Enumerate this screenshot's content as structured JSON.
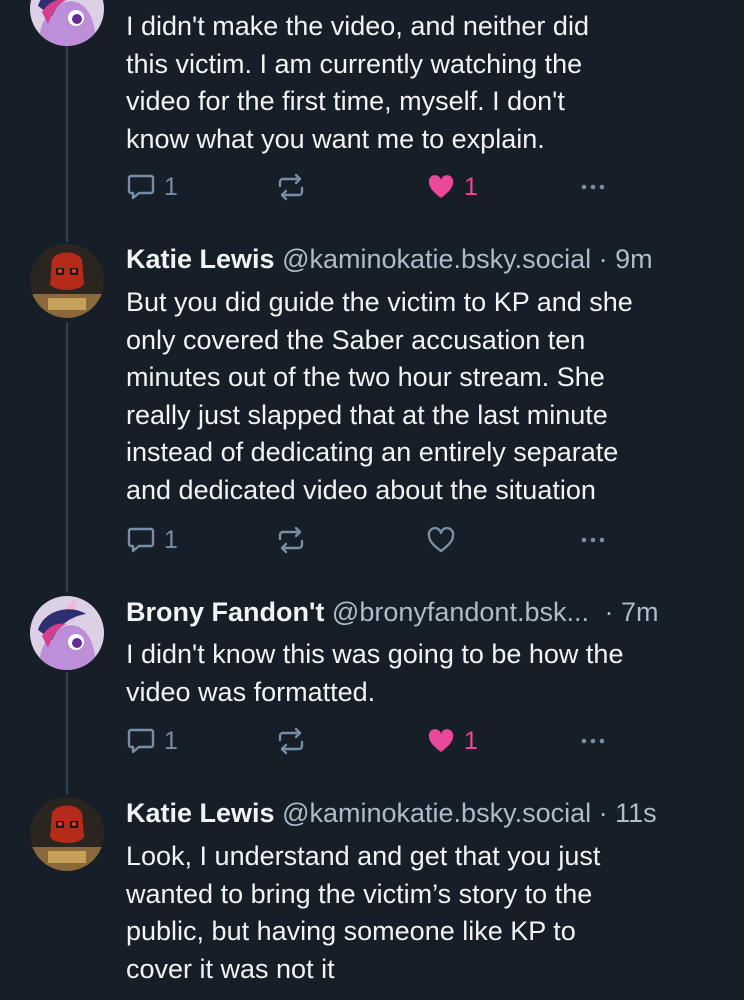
{
  "posts": [
    {
      "author_name": "",
      "handle": "",
      "time": "",
      "text_lines": [
        "I didn't make the video, and neither did",
        "this victim. I am currently watching the",
        "video for the first time, myself. I don't",
        "know what you want me to explain."
      ],
      "reply_count": "1",
      "repost_count": "",
      "like_count": "1",
      "liked": true
    },
    {
      "author_name": "Katie Lewis",
      "handle": "@kaminokatie.bsky.social",
      "separator": "·",
      "time": "9m",
      "text_lines": [
        "But you did guide the victim to KP and she",
        "only covered the Saber accusation ten",
        "minutes out of the two hour stream. She",
        "really just slapped that at the last minute",
        "instead of dedicating an entirely separate",
        "and dedicated video about the situation"
      ],
      "reply_count": "1",
      "repost_count": "",
      "like_count": "",
      "liked": false
    },
    {
      "author_name": "Brony Fandon't",
      "handle": "@bronyfandont.bsk...",
      "separator": "·",
      "time": "7m",
      "text_lines": [
        "I didn't know this was going to be how the",
        "video was formatted."
      ],
      "reply_count": "1",
      "repost_count": "",
      "like_count": "1",
      "liked": true
    },
    {
      "author_name": "Katie Lewis",
      "handle": "@kaminokatie.bsky.social",
      "separator": "·",
      "time": "11s",
      "text_lines": [
        "Look, I understand and get that you just",
        "wanted to bring the victim’s story to the",
        "public, but having someone like KP to",
        "cover it was not it"
      ]
    }
  ],
  "colors": {
    "background": "#161e27",
    "text": "#f1f3f5",
    "muted": "#aebbc9",
    "icon": "#788ea5",
    "like": "#ec4899",
    "thread_line": "#2e4052"
  },
  "icons": {
    "reply": "speech-bubble-icon",
    "repost": "repost-arrows-icon",
    "like": "heart-icon",
    "more": "ellipsis-icon"
  }
}
